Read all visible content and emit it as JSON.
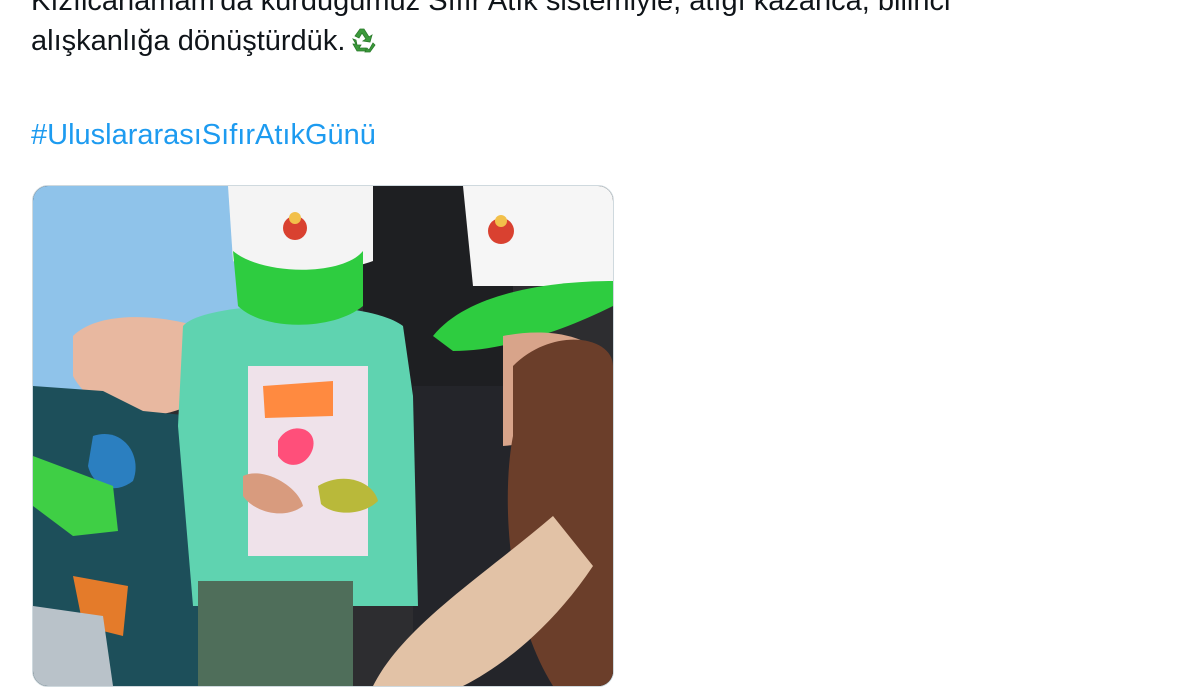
{
  "tweet": {
    "text_line_cut": "Kızılcahamam'da kurduğumuz Sıfır Atık sistemiyle, atığı kazanca, bilinci",
    "text_line_2": "alışkanlığa dönüştürdük.",
    "emoji": "recycle-icon",
    "hashtag": "#UluslararasıSıfırAtıkGünü",
    "media": {
      "kind": "photo"
    }
  },
  "colors": {
    "text": "#0f1419",
    "link": "#1d9bf0",
    "cap_green": "#2ecc40",
    "hijab_blue": "#8fc3ea",
    "sweater_mint": "#5fd3b0"
  }
}
